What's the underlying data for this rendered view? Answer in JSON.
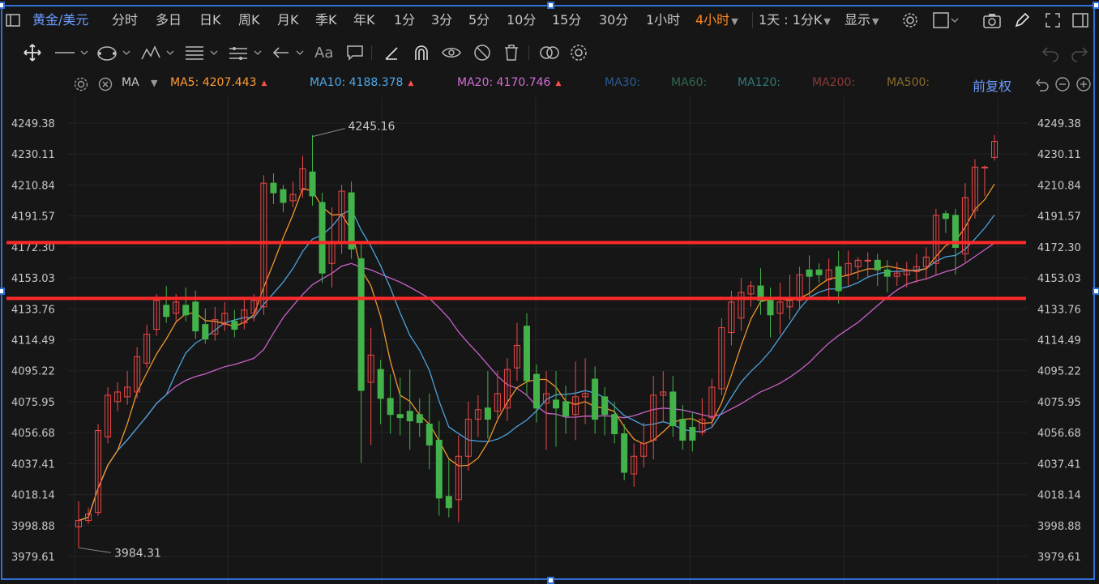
{
  "header": {
    "symbol": "黄金/美元",
    "periods": [
      "分时",
      "多日",
      "日K",
      "周K",
      "月K",
      "季K",
      "年K",
      "1分",
      "3分",
      "5分",
      "10分",
      "15分",
      "30分",
      "1小时",
      "4小时"
    ],
    "active_period": "4小时",
    "settings_label": "1天 : 1分K",
    "display_label": "显示"
  },
  "toolbar": {
    "tools": [
      "move-crosshair-icon",
      "line-tool-icon",
      "shape-tool-icon",
      "pattern-tool-icon",
      "fibonacci-tool-icon",
      "channel-tool-icon",
      "arrow-tool-icon",
      "text-tool-icon",
      "note-tool-icon",
      "ruler-icon",
      "magnet-icon",
      "eye-icon",
      "hide-icon",
      "trash-icon",
      "compare-icon",
      "gear-icon"
    ],
    "text_tool_label": "Aa"
  },
  "indicator": {
    "name": "MA",
    "items": [
      {
        "label": "MA5:",
        "value": "4207.443",
        "color": "#ff9c33",
        "arrow": true
      },
      {
        "label": "MA10:",
        "value": "4188.378",
        "color": "#4ea8e8",
        "arrow": true
      },
      {
        "label": "MA20:",
        "value": "4170.746",
        "color": "#d76bd6",
        "arrow": true
      },
      {
        "label": "MA30:",
        "value": "",
        "color": "#2a5a9a",
        "arrow": false
      },
      {
        "label": "MA60:",
        "value": "",
        "color": "#2f6a4e",
        "arrow": false
      },
      {
        "label": "MA120:",
        "value": "",
        "color": "#2f7a7a",
        "arrow": false
      },
      {
        "label": "MA200:",
        "value": "",
        "color": "#8a3a3a",
        "arrow": false
      },
      {
        "label": "MA500:",
        "value": "",
        "color": "#8a6a2a",
        "arrow": false
      }
    ],
    "adjust_label": "前复权"
  },
  "chart_data": {
    "type": "candlestick",
    "price_labels": [
      "4249.38",
      "4230.11",
      "4210.84",
      "4191.57",
      "4172.30",
      "4153.03",
      "4133.76",
      "4114.49",
      "4095.22",
      "4075.95",
      "4056.68",
      "4037.41",
      "4018.14",
      "3998.88",
      "3979.61"
    ],
    "ylim": [
      3979.61,
      4249.38
    ],
    "high_label": "4245.16",
    "low_label": "3984.31",
    "horizontal_lines": [
      4175.0,
      4140.3
    ],
    "colors": {
      "up": "#f04848",
      "down": "#43b24a",
      "line": "#ff2a2a"
    },
    "candles": [
      [
        4002,
        3998,
        4014,
        3985
      ],
      [
        4006,
        4002,
        4010,
        4000
      ],
      [
        4058,
        4007,
        4062,
        4005
      ],
      [
        4080,
        4054,
        4085,
        4050
      ],
      [
        4082,
        4076,
        4088,
        4070
      ],
      [
        4085,
        4079,
        4095,
        4074
      ],
      [
        4104,
        4082,
        4110,
        4078
      ],
      [
        4118,
        4100,
        4124,
        4097
      ],
      [
        4139,
        4121,
        4143,
        4117
      ],
      [
        4129,
        4136,
        4148,
        4125
      ],
      [
        4138,
        4131,
        4143,
        4126
      ],
      [
        4130,
        4136,
        4147,
        4126
      ],
      [
        4120,
        4138,
        4145,
        4115
      ],
      [
        4115,
        4124,
        4134,
        4112
      ],
      [
        4127,
        4118,
        4135,
        4114
      ],
      [
        4131,
        4124,
        4138,
        4120
      ],
      [
        4121,
        4126,
        4133,
        4116
      ],
      [
        4133,
        4125,
        4140,
        4121
      ],
      [
        4139,
        4131,
        4143,
        4126
      ],
      [
        4212,
        4135,
        4217,
        4130
      ],
      [
        4206,
        4212,
        4218,
        4199
      ],
      [
        4200,
        4208,
        4211,
        4194
      ],
      [
        4205,
        4201,
        4213,
        4197
      ],
      [
        4221,
        4208,
        4229,
        4203
      ],
      [
        4204,
        4219,
        4242,
        4198
      ],
      [
        4156,
        4200,
        4206,
        4150
      ],
      [
        4175,
        4162,
        4197,
        4147
      ],
      [
        4207,
        4175,
        4211,
        4168
      ],
      [
        4171,
        4206,
        4213,
        4165
      ],
      [
        4083,
        4165,
        4175,
        4038
      ],
      [
        4105,
        4088,
        4122,
        4049
      ],
      [
        4078,
        4096,
        4102,
        4062
      ],
      [
        4068,
        4078,
        4093,
        4056
      ],
      [
        4066,
        4068,
        4091,
        4055
      ],
      [
        4064,
        4070,
        4096,
        4046
      ],
      [
        4063,
        4068,
        4078,
        4054
      ],
      [
        4049,
        4062,
        4081,
        4034
      ],
      [
        4016,
        4052,
        4064,
        4005
      ],
      [
        4010,
        4017,
        4040,
        4004
      ],
      [
        4042,
        4015,
        4055,
        4001
      ],
      [
        4065,
        4042,
        4076,
        4033
      ],
      [
        4071,
        4065,
        4080,
        4054
      ],
      [
        4065,
        4072,
        4095,
        4053
      ],
      [
        4081,
        4070,
        4095,
        4065
      ],
      [
        4096,
        4072,
        4103,
        4064
      ],
      [
        4111,
        4097,
        4125,
        4089
      ],
      [
        4089,
        4123,
        4131,
        4080
      ],
      [
        4072,
        4093,
        4099,
        4063
      ],
      [
        4081,
        4075,
        4095,
        4046
      ],
      [
        4072,
        4077,
        4095,
        4048
      ],
      [
        4067,
        4076,
        4086,
        4056
      ],
      [
        4079,
        4068,
        4101,
        4052
      ],
      [
        4081,
        4079,
        4103,
        4062
      ],
      [
        4065,
        4090,
        4098,
        4056
      ],
      [
        4068,
        4079,
        4085,
        4055
      ],
      [
        4056,
        4068,
        4076,
        4050
      ],
      [
        4032,
        4056,
        4062,
        4027
      ],
      [
        4042,
        4031,
        4050,
        4023
      ],
      [
        4050,
        4042,
        4063,
        4035
      ],
      [
        4080,
        4052,
        4092,
        4040
      ],
      [
        4082,
        4080,
        4095,
        4063
      ],
      [
        4061,
        4082,
        4092,
        4054
      ],
      [
        4052,
        4065,
        4074,
        4046
      ],
      [
        4052,
        4060,
        4069,
        4045
      ],
      [
        4065,
        4057,
        4078,
        4055
      ],
      [
        4085,
        4066,
        4090,
        4060
      ],
      [
        4122,
        4084,
        4128,
        4080
      ],
      [
        4138,
        4119,
        4145,
        4111
      ],
      [
        4144,
        4128,
        4153,
        4120
      ],
      [
        4148,
        4143,
        4151,
        4135
      ],
      [
        4139,
        4148,
        4159,
        4130
      ],
      [
        4130,
        4139,
        4147,
        4116
      ],
      [
        4138,
        4131,
        4150,
        4118
      ],
      [
        4140,
        4135,
        4155,
        4127
      ],
      [
        4155,
        4139,
        4160,
        4134
      ],
      [
        4154,
        4158,
        4167,
        4140
      ],
      [
        4155,
        4158,
        4162,
        4150
      ],
      [
        4158,
        4152,
        4165,
        4139
      ],
      [
        4145,
        4160,
        4170,
        4137
      ],
      [
        4162,
        4155,
        4170,
        4148
      ],
      [
        4164,
        4160,
        4166,
        4152
      ],
      [
        4164,
        4164,
        4169,
        4153
      ],
      [
        4158,
        4164,
        4168,
        4148
      ],
      [
        4154,
        4158,
        4164,
        4144
      ],
      [
        4156,
        4154,
        4163,
        4148
      ],
      [
        4158,
        4155,
        4163,
        4147
      ],
      [
        4160,
        4157,
        4168,
        4150
      ],
      [
        4166,
        4160,
        4172,
        4152
      ],
      [
        4192,
        4162,
        4196,
        4155
      ],
      [
        4190,
        4193,
        4195,
        4181
      ],
      [
        4172,
        4192,
        4196,
        4155
      ],
      [
        4203,
        4168,
        4212,
        4163
      ],
      [
        4222,
        4195,
        4227,
        4190
      ],
      [
        4222,
        4222,
        4223,
        4204
      ],
      [
        4238,
        4228,
        4242,
        4226
      ]
    ],
    "ma5_end": 4207.443,
    "ma10_end": 4188.378,
    "ma20_end": 4170.746
  },
  "icons": {
    "right": [
      "camera-icon",
      "pencil-icon",
      "fullscreen-icon",
      "sidebar-icon"
    ],
    "ma_controls": [
      "gear-icon",
      "close-icon",
      "chevron-down-icon"
    ],
    "zoom": [
      "undo-icon",
      "zoom-out-icon",
      "zoom-in-icon"
    ]
  }
}
